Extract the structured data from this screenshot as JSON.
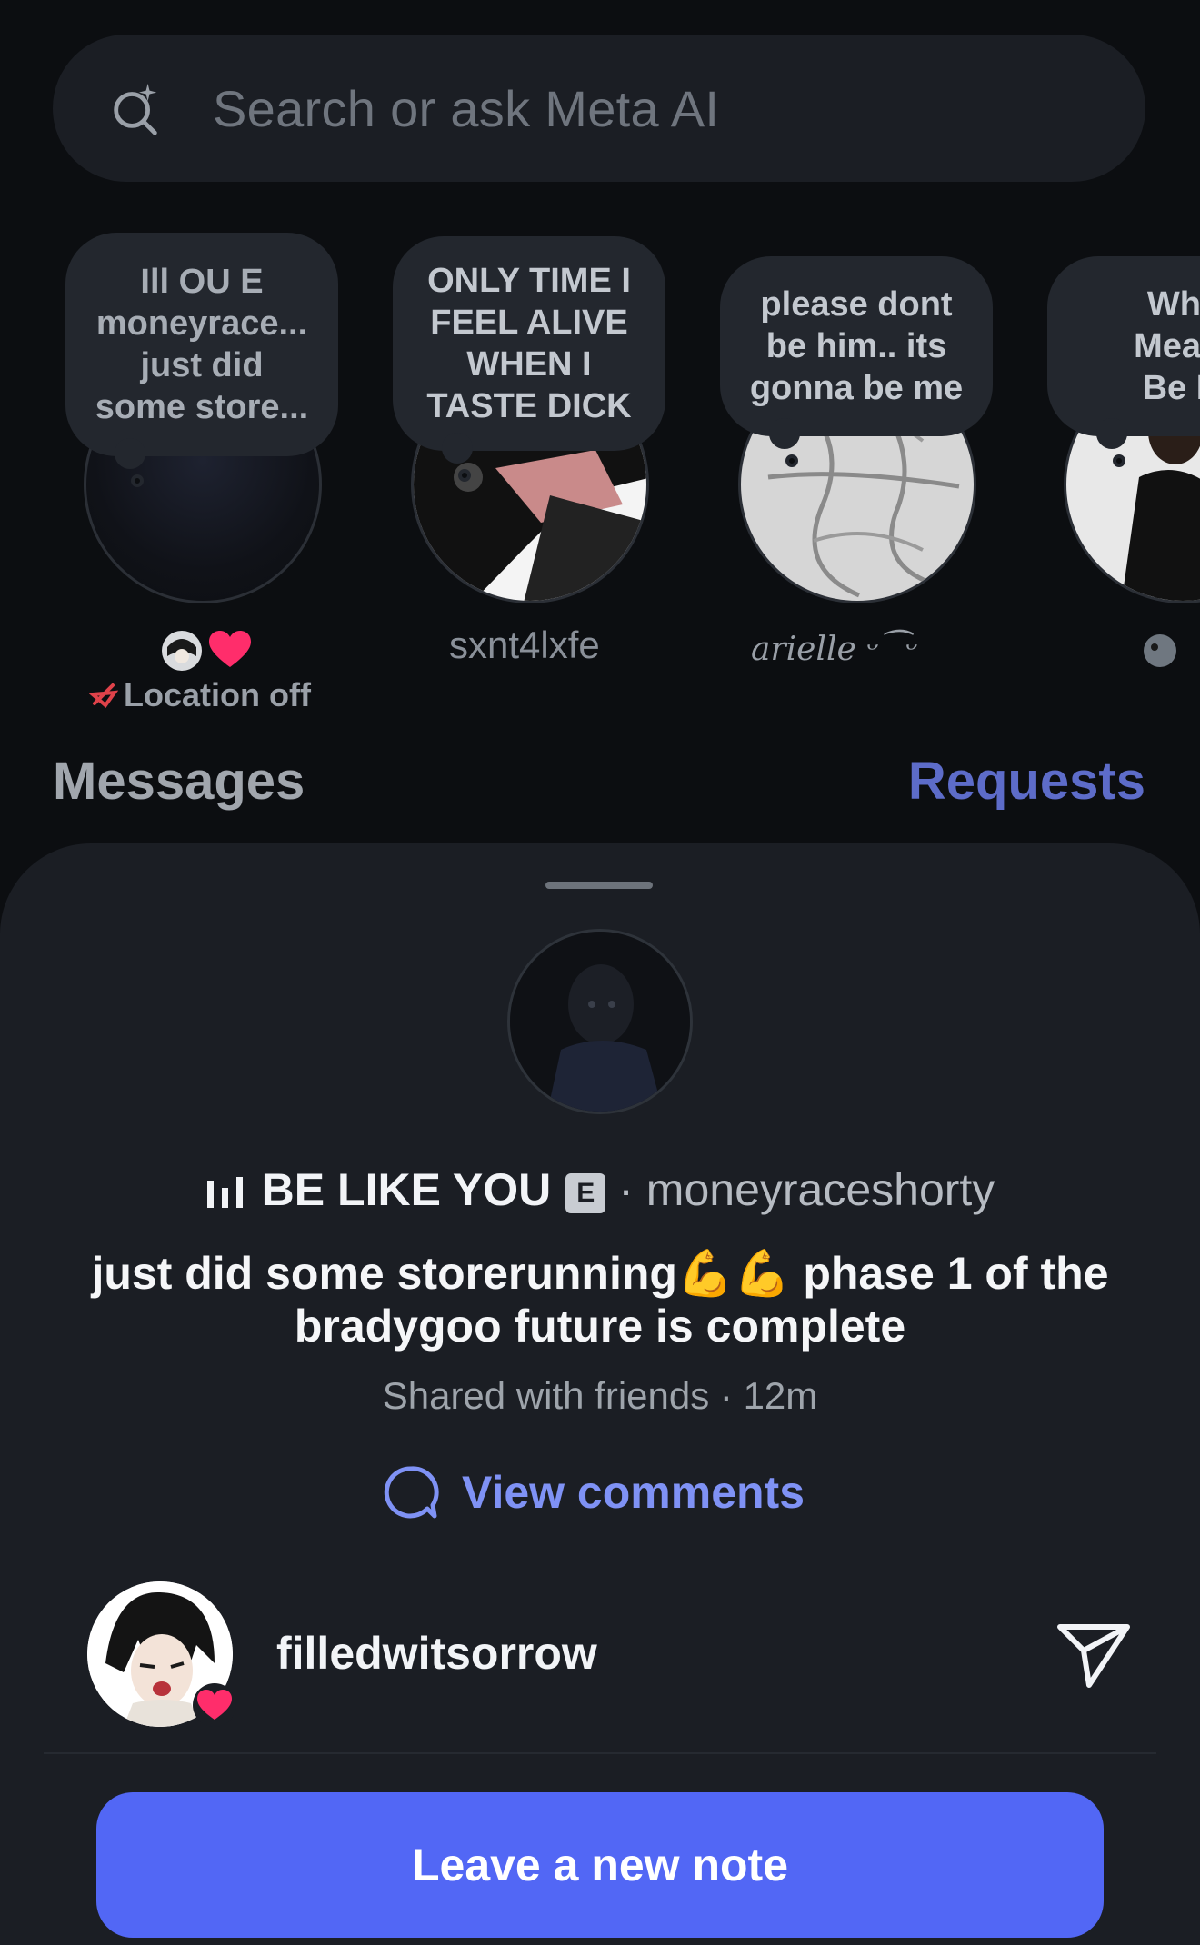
{
  "search": {
    "placeholder": "Search or ask Meta AI"
  },
  "notes": [
    {
      "bubble_lines": [
        "Ill OU E",
        "moneyrace...",
        "just did",
        "some store..."
      ],
      "name": "",
      "status": "Location off"
    },
    {
      "bubble_lines": [
        "ONLY TIME I",
        "FEEL ALIVE",
        "WHEN I",
        "TASTE DICK"
      ],
      "name": "sxnt4lxfe"
    },
    {
      "bubble_lines": [
        "please dont",
        "be him.. its",
        "gonna be me"
      ],
      "name": "arielle ᵕ⁀ᵕ"
    },
    {
      "bubble_lines": [
        "Wha",
        "Meant",
        "Be M"
      ],
      "name": ""
    }
  ],
  "section": {
    "title": "Messages",
    "requests": "Requests"
  },
  "sheet": {
    "song": "BE LIKE YOU",
    "explicit": "E",
    "artist": "· moneyraceshorty",
    "note_text": "just did some storerunning💪💪 phase 1 of the bradygoo future is complete",
    "meta": "Shared with friends · 12m",
    "view_comments": "View comments",
    "reply_user": "filledwitsorrow",
    "leave_note": "Leave a new note"
  },
  "colors": {
    "accent": "#5267f5",
    "link": "#7f92f5",
    "heart": "#ff2d6b"
  }
}
